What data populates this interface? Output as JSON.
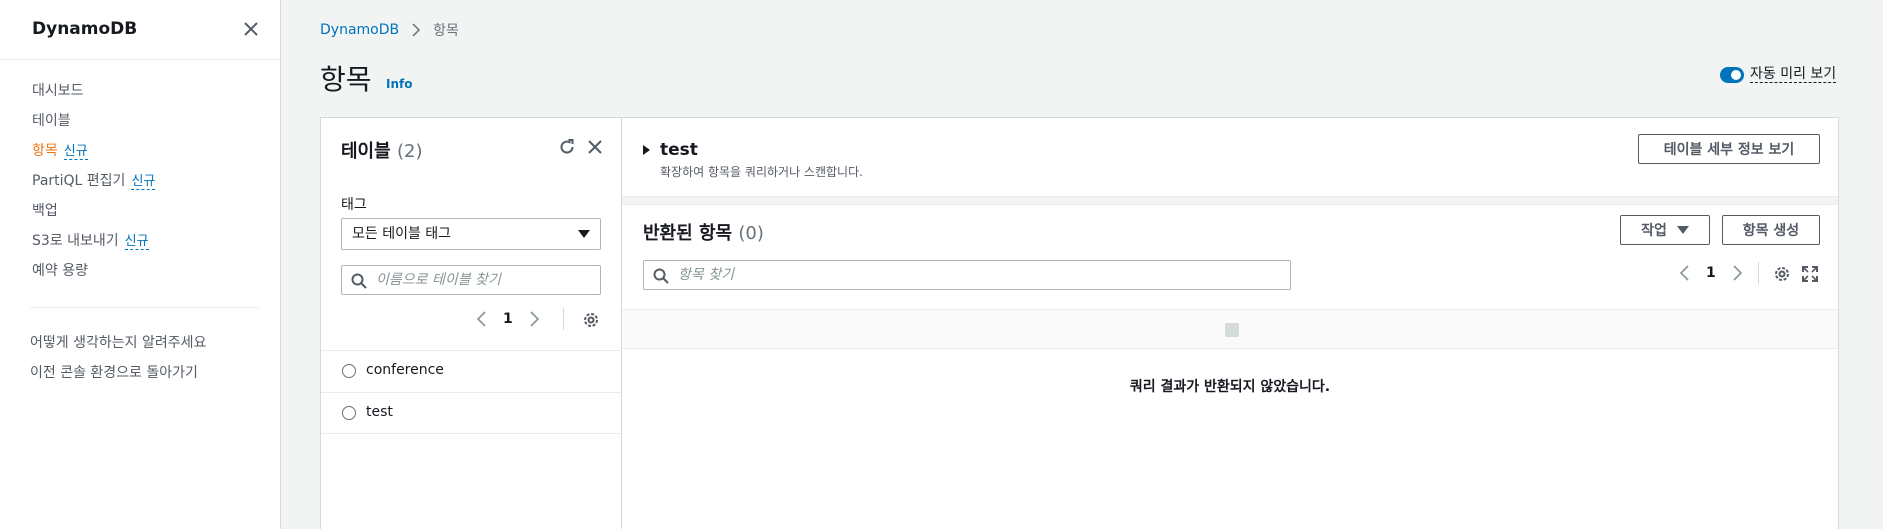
{
  "sidebar": {
    "title": "DynamoDB",
    "items": [
      {
        "label": "대시보드",
        "active": false,
        "badge": ""
      },
      {
        "label": "테이블",
        "active": false,
        "badge": ""
      },
      {
        "label": "항목",
        "active": true,
        "badge": "신규"
      },
      {
        "label": "PartiQL 편집기",
        "active": false,
        "badge": "신규"
      },
      {
        "label": "백업",
        "active": false,
        "badge": ""
      },
      {
        "label": "S3로 내보내기",
        "active": false,
        "badge": "신규"
      },
      {
        "label": "예약 용량",
        "active": false,
        "badge": ""
      }
    ],
    "links": [
      {
        "label": "어떻게 생각하는지 알려주세요"
      },
      {
        "label": "이전 콘솔 환경으로 돌아가기"
      }
    ]
  },
  "breadcrumb": {
    "root": "DynamoDB",
    "current": "항목"
  },
  "page": {
    "title": "항목",
    "info": "Info",
    "auto_preview_label": "자동 미리 보기",
    "auto_preview_on": true
  },
  "tables_panel": {
    "title": "테이블",
    "count": "(2)",
    "tag_label": "태그",
    "tag_select_value": "모든 테이블 태그",
    "search_placeholder": "이름으로 테이블 찾기",
    "page": "1",
    "tables": [
      {
        "name": "conference"
      },
      {
        "name": "test"
      }
    ]
  },
  "items_panel": {
    "table_name": "test",
    "description": "확장하여 항목을 쿼리하거나 스캔합니다.",
    "details_button": "테이블 세부 정보 보기",
    "results_title": "반환된 항목",
    "results_count": "(0)",
    "actions_button": "작업",
    "create_button": "항목 생성",
    "search_placeholder": "항목 찾기",
    "page": "1",
    "empty_message": "쿼리 결과가 반환되지 않았습니다."
  },
  "colors": {
    "accent": "#0073bb",
    "active_nav": "#ec7211",
    "background": "#f2f3f3"
  }
}
